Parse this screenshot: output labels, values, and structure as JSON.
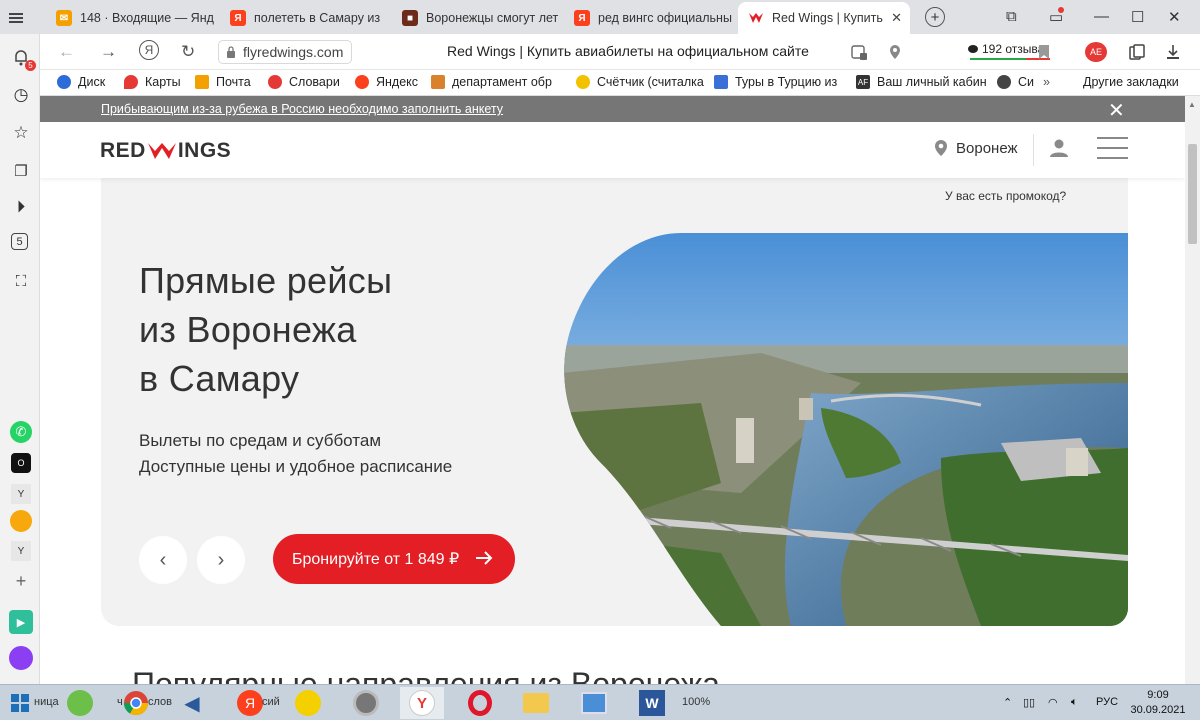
{
  "browser": {
    "tabs": [
      {
        "label": "148 · Входящие — Янд",
        "icon": "mail-icon",
        "color": "#f2a100",
        "active": false
      },
      {
        "label": "полететь в Самару из",
        "icon": "yandex-icon",
        "color": "#fc3f1d",
        "active": false
      },
      {
        "label": "Воронежцы смогут лет",
        "icon": "news-icon",
        "color": "#6b2a1a",
        "active": false
      },
      {
        "label": "ред вингс официальны",
        "icon": "yandex-icon",
        "color": "#fc3f1d",
        "active": false
      },
      {
        "label": "Red Wings | Купить",
        "icon": "redwings-icon",
        "color": "#e31e24",
        "active": true
      }
    ],
    "url": "flyredwings.com",
    "page_title": "Red Wings | Купить авиабилеты на официальном сайте",
    "reviews": "192 отзыва",
    "profile_badge": "AE",
    "notification_count": "5",
    "bookmarks": [
      {
        "label": "Диск",
        "color": "#2b6cd8"
      },
      {
        "label": "Карты",
        "color": "#e53935"
      },
      {
        "label": "Почта",
        "color": "#f2a100"
      },
      {
        "label": "Словари",
        "color": "#e53935"
      },
      {
        "label": "Яндекс",
        "color": "#fc3f1d"
      },
      {
        "label": "департамент обр",
        "color": "#d9822b"
      },
      {
        "label": "Счётчик (считалка",
        "color": "#f2c200"
      },
      {
        "label": "Туры в Турцию из",
        "color": "#3a6fd8"
      },
      {
        "label": "Ваш личный кабин",
        "color": "#333333"
      },
      {
        "label": "Си",
        "color": "#444444"
      }
    ],
    "bookmarks_more": "Другие закладки"
  },
  "site": {
    "notice": "Прибывающим из-за рубежа в Россию необходимо заполнить анкету",
    "logo": {
      "left": "RED",
      "right": "INGS"
    },
    "city": "Воронеж",
    "promo": "У вас есть промокод?",
    "hero": {
      "title_lines": [
        "Прямые рейсы",
        "из Воронежа",
        "в Самару"
      ],
      "subtitle_lines": [
        "Вылеты по средам и субботам",
        "Доступные цены и удобное расписание"
      ],
      "book_label": "Бронируйте от 1 849 ₽"
    },
    "popular_heading": "Популярные направления из Воронежа",
    "brand_red": "#e31e24"
  },
  "taskbar": {
    "language": "РУС",
    "time": "9:09",
    "date": "30.09.2021",
    "zoom": "100%",
    "labels": [
      "ница",
      "ч",
      "слов",
      "сий"
    ]
  }
}
